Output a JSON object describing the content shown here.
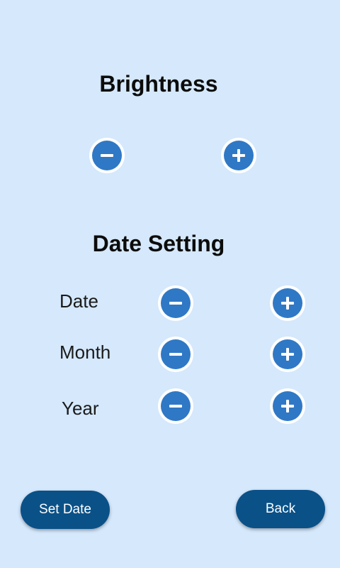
{
  "brightness": {
    "title": "Brightness",
    "decrease_icon": "minus-circle-icon",
    "increase_icon": "plus-circle-icon"
  },
  "date_setting": {
    "title": "Date Setting",
    "rows": [
      {
        "label": "Date"
      },
      {
        "label": "Month"
      },
      {
        "label": "Year"
      }
    ]
  },
  "footer": {
    "set_date_label": "Set Date",
    "back_label": "Back"
  },
  "colors": {
    "background": "#d5e8fc",
    "button_fill": "#2f78c6",
    "pill_fill": "#0a5188"
  }
}
